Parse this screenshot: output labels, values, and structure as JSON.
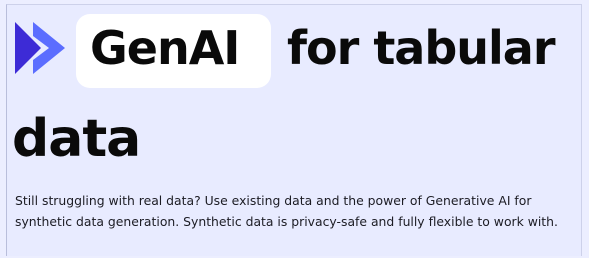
{
  "hero": {
    "highlight": "GenAI",
    "title_rest": "for tabular",
    "title_line2": "data"
  },
  "description": "Still struggling with real data? Use existing data and the power of Generative AI for synthetic data generation. Synthetic data is privacy-safe and fully flexible to work with.",
  "colors": {
    "page_background": "#e8ebff",
    "logo_dark": "#3d2bd6",
    "logo_light": "#5b6dff",
    "highlight_background": "#ffffff",
    "text": "#0a0a0a"
  },
  "icons": {
    "logo": "double-chevron-right-icon"
  }
}
